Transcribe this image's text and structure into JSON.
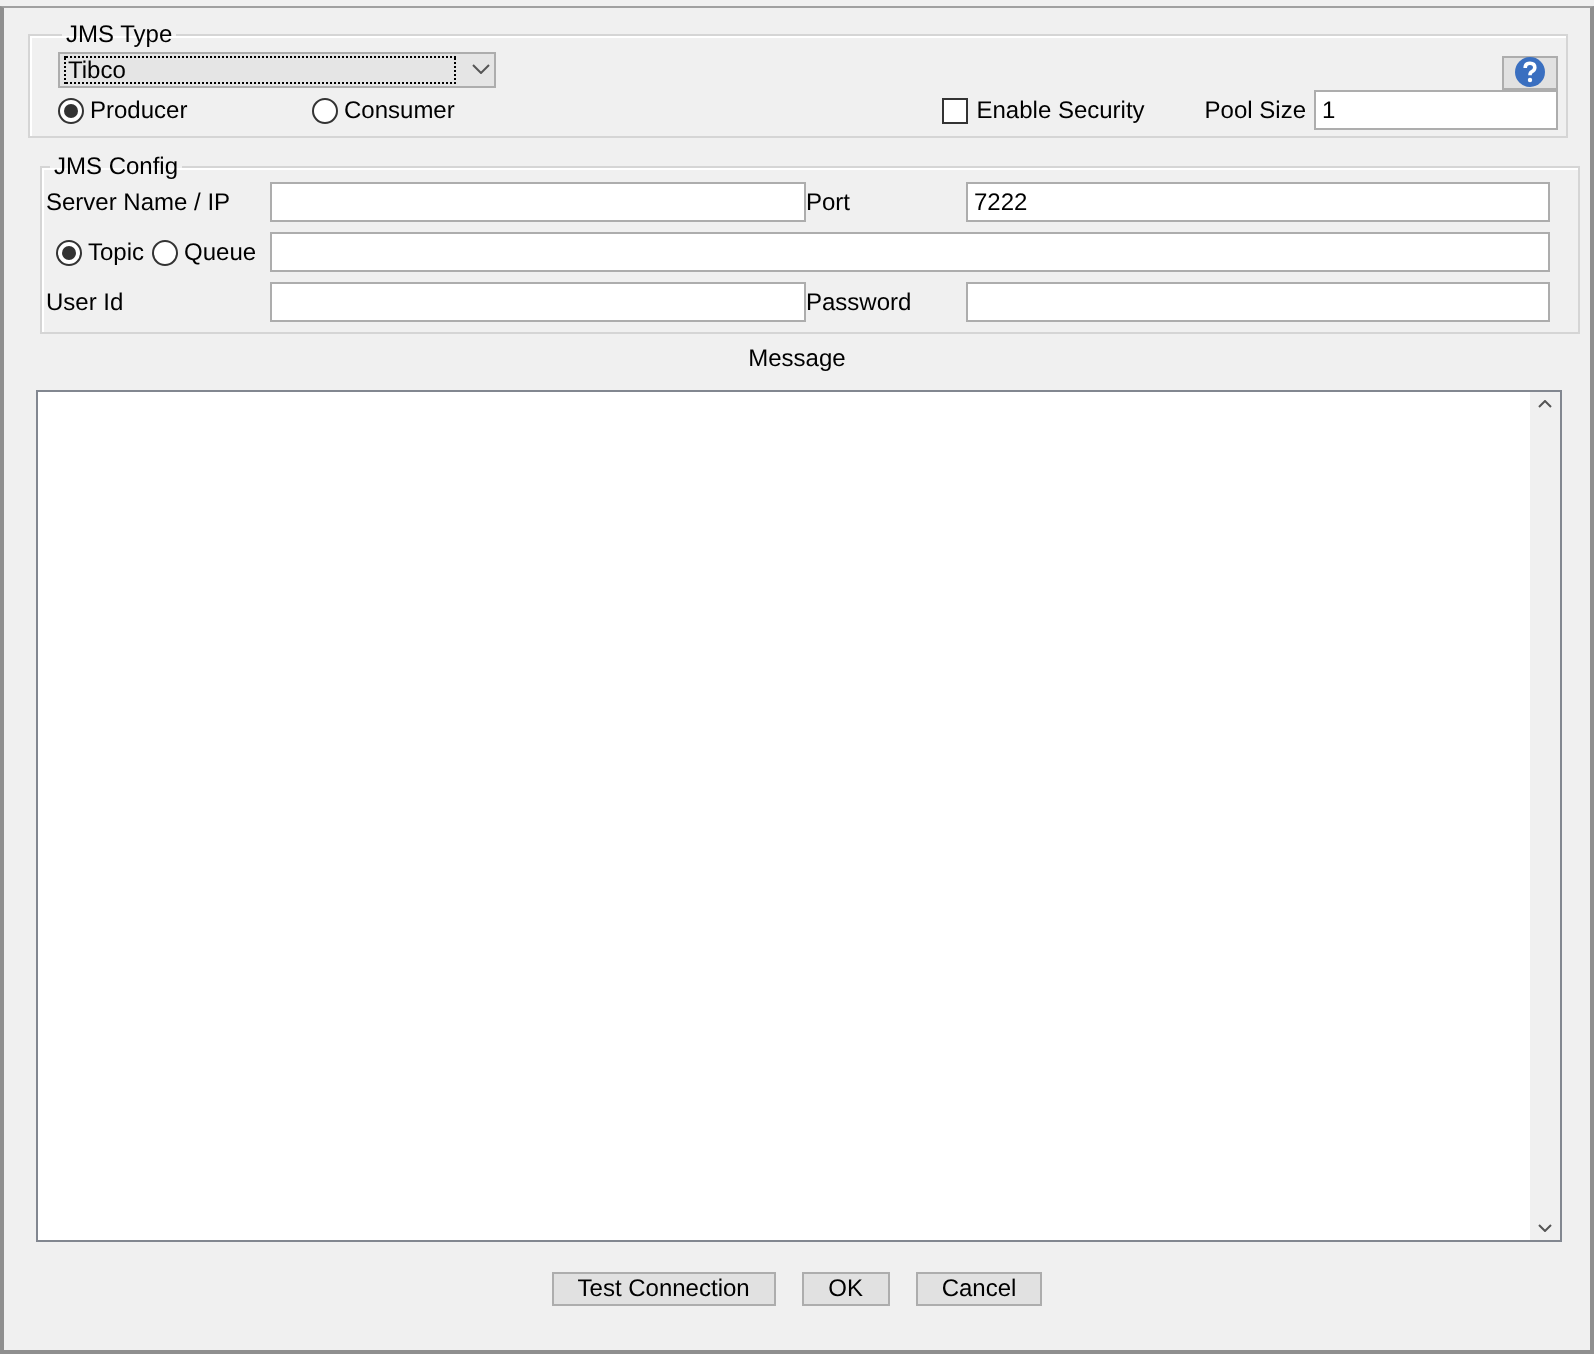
{
  "jms_type": {
    "legend": "JMS Type",
    "type_select": {
      "value": "Tibco"
    },
    "modes": [
      {
        "label": "Producer",
        "selected": true
      },
      {
        "label": "Consumer",
        "selected": false
      }
    ],
    "enable_security": {
      "label": "Enable Security",
      "checked": false
    },
    "pool_size": {
      "label": "Pool Size",
      "value": "1"
    }
  },
  "jms_config": {
    "legend": "JMS Config",
    "server": {
      "label": "Server Name / IP"
    },
    "port": {
      "label": "Port",
      "value": "7222"
    },
    "destination_types": [
      {
        "label": "Topic",
        "selected": true
      },
      {
        "label": "Queue",
        "selected": false
      }
    ],
    "user_id": {
      "label": "User Id"
    },
    "password": {
      "label": "Password"
    }
  },
  "message": {
    "label": "Message"
  },
  "buttons": [
    {
      "label": "Test Connection"
    },
    {
      "label": "OK"
    },
    {
      "label": "Cancel"
    }
  ]
}
